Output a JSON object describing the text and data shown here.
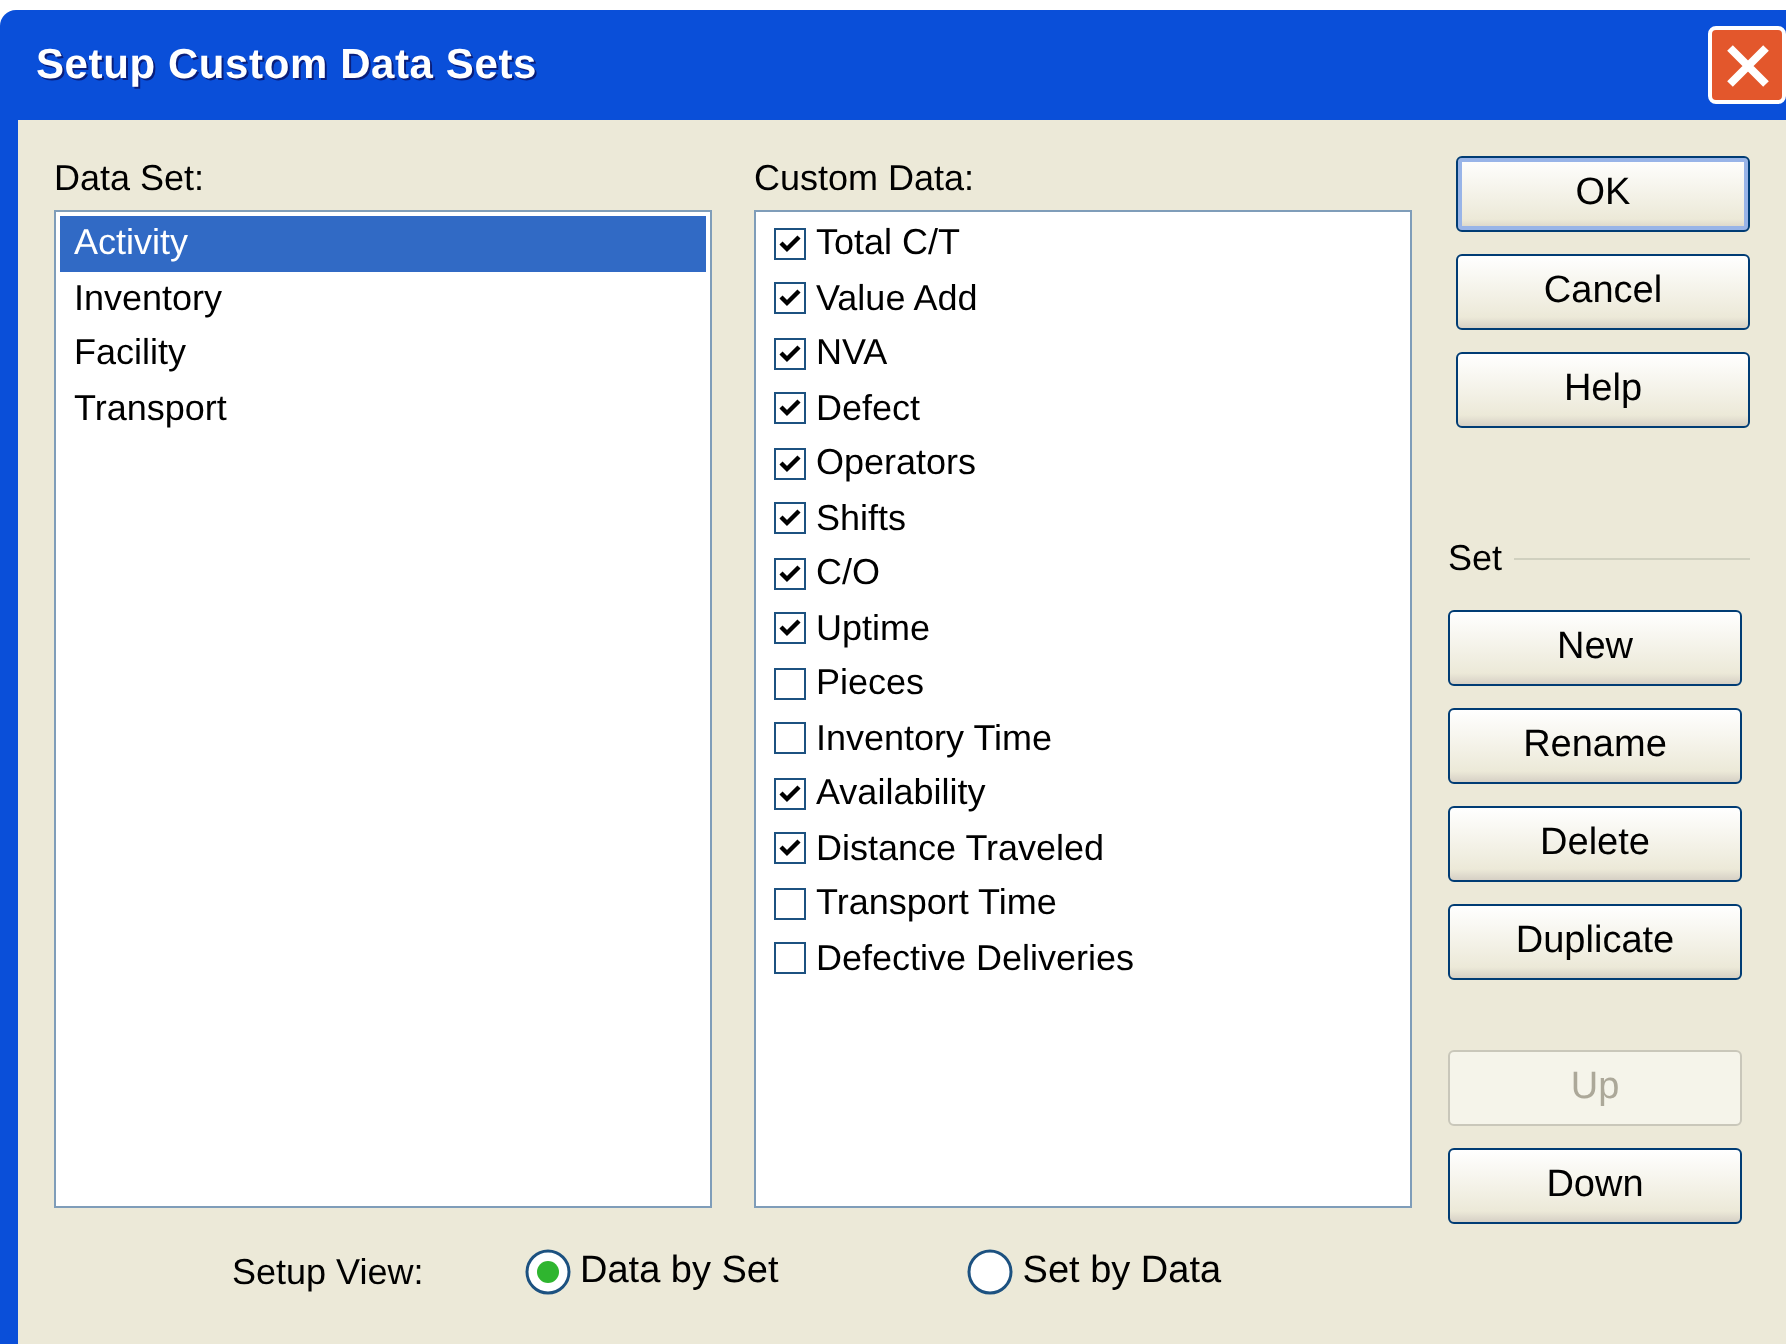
{
  "window": {
    "title": "Setup Custom Data Sets"
  },
  "data_set": {
    "label": "Data Set:",
    "items": [
      {
        "label": "Activity",
        "selected": true
      },
      {
        "label": "Inventory",
        "selected": false
      },
      {
        "label": "Facility",
        "selected": false
      },
      {
        "label": "Transport",
        "selected": false
      }
    ]
  },
  "custom_data": {
    "label": "Custom Data:",
    "items": [
      {
        "label": "Total C/T",
        "checked": true
      },
      {
        "label": "Value Add",
        "checked": true
      },
      {
        "label": "NVA",
        "checked": true
      },
      {
        "label": "Defect",
        "checked": true
      },
      {
        "label": "Operators",
        "checked": true
      },
      {
        "label": "Shifts",
        "checked": true
      },
      {
        "label": "C/O",
        "checked": true
      },
      {
        "label": "Uptime",
        "checked": true
      },
      {
        "label": "Pieces",
        "checked": false
      },
      {
        "label": "Inventory Time",
        "checked": false
      },
      {
        "label": "Availability",
        "checked": true
      },
      {
        "label": "Distance Traveled",
        "checked": true
      },
      {
        "label": "Transport Time",
        "checked": false
      },
      {
        "label": "Defective Deliveries",
        "checked": false
      }
    ]
  },
  "dialog_buttons": [
    {
      "label": "OK",
      "default": true
    },
    {
      "label": "Cancel",
      "default": false
    },
    {
      "label": "Help",
      "default": false
    }
  ],
  "set_group": {
    "label": "Set",
    "buttons": [
      {
        "label": "New",
        "disabled": false
      },
      {
        "label": "Rename",
        "disabled": false
      },
      {
        "label": "Delete",
        "disabled": false
      },
      {
        "label": "Duplicate",
        "disabled": false
      },
      {
        "label": "Up",
        "disabled": true
      },
      {
        "label": "Down",
        "disabled": false
      }
    ]
  },
  "setup_view": {
    "label": "Setup View:",
    "options": [
      {
        "label": "Data by Set",
        "selected": true
      },
      {
        "label": "Set by Data",
        "selected": false
      }
    ]
  }
}
